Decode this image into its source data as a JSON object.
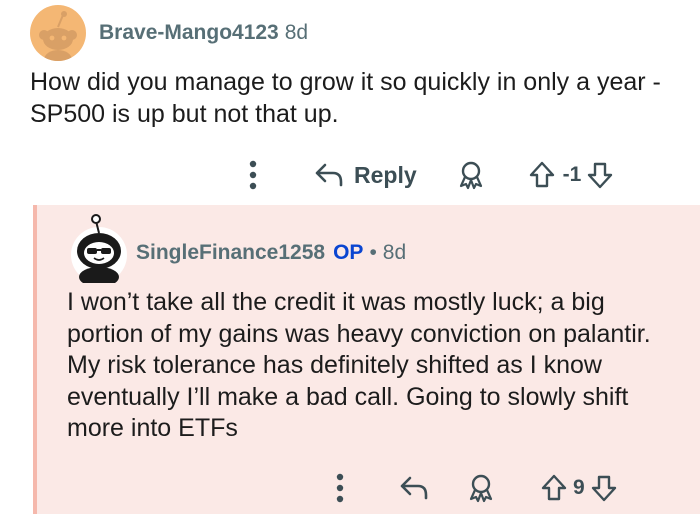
{
  "comments": [
    {
      "author": "Brave-Mango4123",
      "age": "8d",
      "body": "How did you manage to grow it so quickly in only a year - SP500 is up but not that up.",
      "actions": {
        "reply_label": "Reply",
        "vote_count": "-1"
      }
    },
    {
      "author": "SingleFinance1258",
      "op_badge": "OP",
      "separator": "•",
      "age": "8d",
      "body": "I won’t take all the credit it was mostly luck; a big portion of my gains was heavy conviction on palantir. My risk tolerance has definitely shifted as I know eventually I’ll make a bad call. Going to slowly shift more into ETFs",
      "actions": {
        "vote_count": "9"
      }
    }
  ],
  "colors": {
    "reply_background": "#fbe9e6",
    "thread_line": "#f5b8ac",
    "op_badge": "#0a45d1",
    "meta_text": "#576f76",
    "avatar_orange": "#f4b774"
  },
  "icons": {
    "more": "more-options-icon",
    "reply": "reply-arrow-icon",
    "award": "award-icon",
    "upvote": "upvote-arrow-icon",
    "downvote": "downvote-arrow-icon"
  }
}
